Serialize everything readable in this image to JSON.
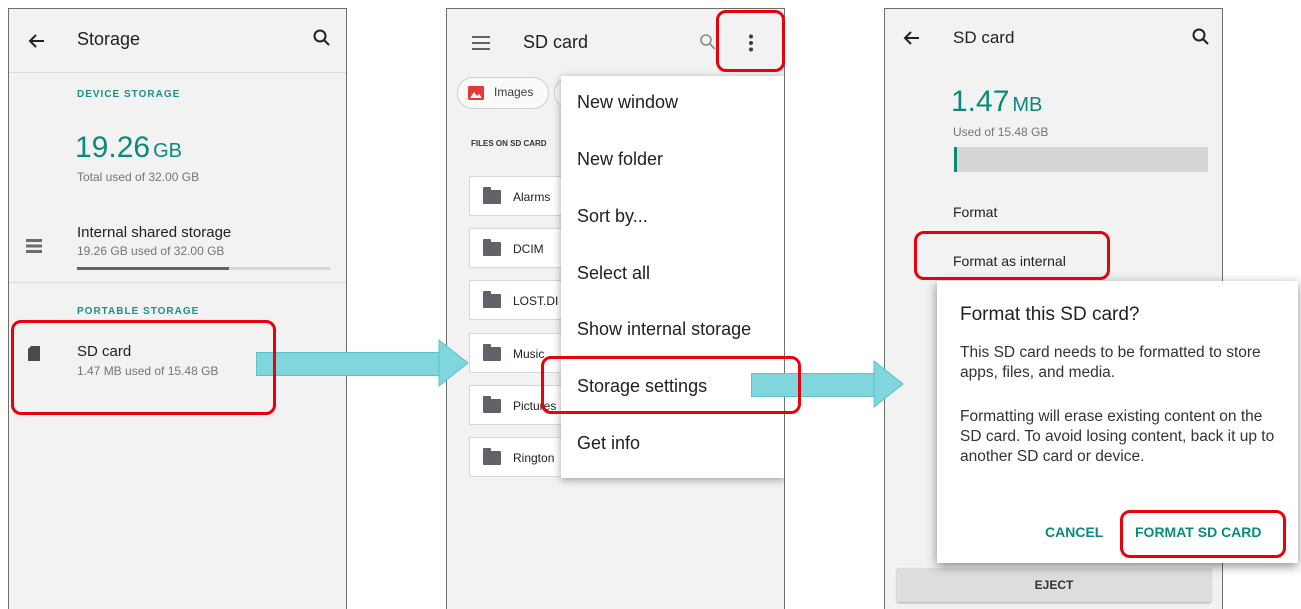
{
  "screen1": {
    "title": "Storage",
    "device_section": "DEVICE STORAGE",
    "used_value": "19.26",
    "used_unit": "GB",
    "used_caption": "Total used of 32.00 GB",
    "internal_title": "Internal shared storage",
    "internal_sub": "19.26 GB used of 32.00 GB",
    "internal_fill": 0.6,
    "portable_section": "PORTABLE STORAGE",
    "sd_title": "SD card",
    "sd_sub": "1.47 MB used of 15.48 GB"
  },
  "screen2": {
    "title": "SD card",
    "chip_label": "Images",
    "files_header": "FILES ON SD CARD",
    "files": [
      "Alarms",
      "DCIM",
      "LOST.DI",
      "Music",
      "Pictures",
      "Rington"
    ],
    "menu": [
      "New window",
      "New folder",
      "Sort by...",
      "Select all",
      "Show internal storage",
      "Storage settings",
      "Get info"
    ]
  },
  "screen3": {
    "title": "SD card",
    "used_value": "1.47",
    "used_unit": "MB",
    "used_caption": "Used of 15.48 GB",
    "used_fill": 0.01,
    "format_label": "Format",
    "format_internal_label": "Format as internal",
    "dialog": {
      "title": "Format this SD card?",
      "body1": "This SD card needs to be formatted to store apps, files, and media.",
      "body2": "Formatting will erase existing content on the SD card. To avoid losing content, back it up to another SD card or device.",
      "cancel": "CANCEL",
      "confirm": "FORMAT SD CARD"
    },
    "eject": "EJECT"
  },
  "colors": {
    "accent": "#0a8a7c",
    "highlight": "#e8000b",
    "arrow": "#7fd6dd"
  }
}
